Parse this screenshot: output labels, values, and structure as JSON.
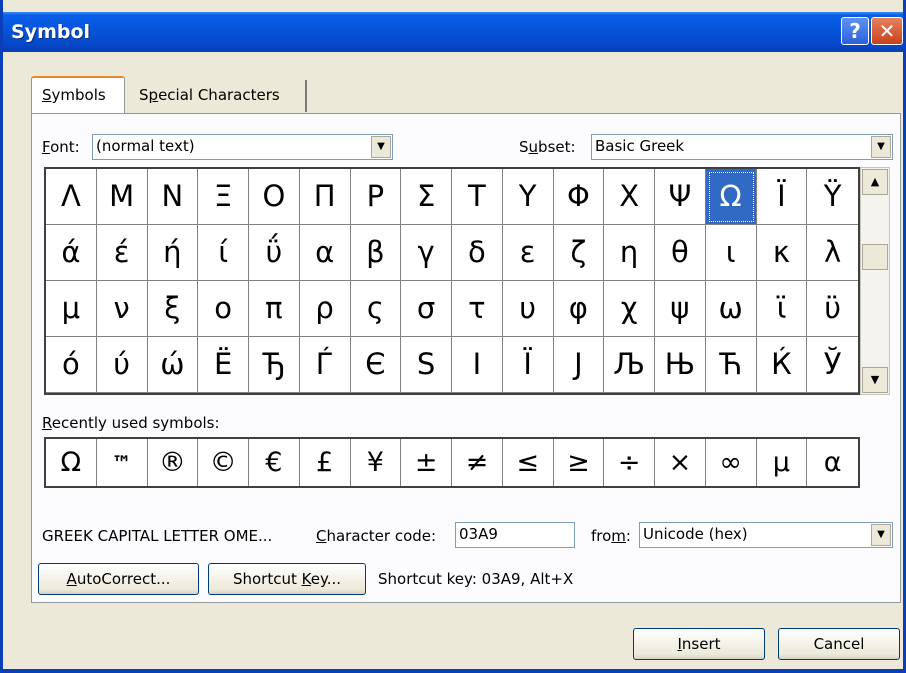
{
  "dialog": {
    "title": "Symbol",
    "help_label": "?",
    "close_label": "✕"
  },
  "tabs": [
    {
      "pre": "",
      "u": "S",
      "post": "ymbols"
    },
    {
      "pre": "S",
      "u": "p",
      "post": "ecial Characters"
    }
  ],
  "font": {
    "pre": "",
    "u": "F",
    "post": "ont:",
    "value": "(normal text)"
  },
  "subset": {
    "pre": "S",
    "u": "u",
    "post": "bset:",
    "value": "Basic Greek"
  },
  "symbols": [
    "Λ",
    "Μ",
    "Ν",
    "Ξ",
    "Ο",
    "Π",
    "Ρ",
    "Σ",
    "Τ",
    "Υ",
    "Φ",
    "Χ",
    "Ψ",
    "Ω",
    "Ϊ",
    "Ϋ",
    "ά",
    "έ",
    "ή",
    "ί",
    "ΰ",
    "α",
    "β",
    "γ",
    "δ",
    "ε",
    "ζ",
    "η",
    "θ",
    "ι",
    "κ",
    "λ",
    "μ",
    "ν",
    "ξ",
    "ο",
    "π",
    "ρ",
    "ς",
    "σ",
    "τ",
    "υ",
    "φ",
    "χ",
    "ψ",
    "ω",
    "ϊ",
    "ϋ",
    "ό",
    "ύ",
    "ώ",
    "Ё",
    "Ђ",
    "Ѓ",
    "Є",
    "Ѕ",
    "І",
    "Ї",
    "Ј",
    "Љ",
    "Њ",
    "Ћ",
    "Ќ",
    "Ў"
  ],
  "selected_index": 13,
  "recent": {
    "pre": "",
    "u": "R",
    "post": "ecently used symbols:",
    "symbols": [
      "Ω",
      "™",
      "®",
      "©",
      "€",
      "£",
      "¥",
      "±",
      "≠",
      "≤",
      "≥",
      "÷",
      "×",
      "∞",
      "µ",
      "α"
    ]
  },
  "char_name": "GREEK CAPITAL LETTER OME...",
  "char_code": {
    "pre": "",
    "u": "C",
    "post": "haracter code:",
    "value": "03A9"
  },
  "from": {
    "pre": "fro",
    "u": "m",
    "post": ":",
    "value": "Unicode (hex)"
  },
  "buttons": {
    "autocorrect": {
      "pre": "",
      "u": "A",
      "post": "utoCorrect..."
    },
    "shortcut": {
      "pre": "Shortcut ",
      "u": "K",
      "post": "ey..."
    },
    "insert": {
      "pre": "",
      "u": "I",
      "post": "nsert"
    },
    "cancel": "Cancel"
  },
  "shortcut_text": "Shortcut key: 03A9, Alt+X",
  "scroll": {
    "up": "▲",
    "down": "▼"
  },
  "dropdown_arrow": "▼",
  "colors": {
    "selection": "#316ac5",
    "title_bar": "#0653d8"
  }
}
